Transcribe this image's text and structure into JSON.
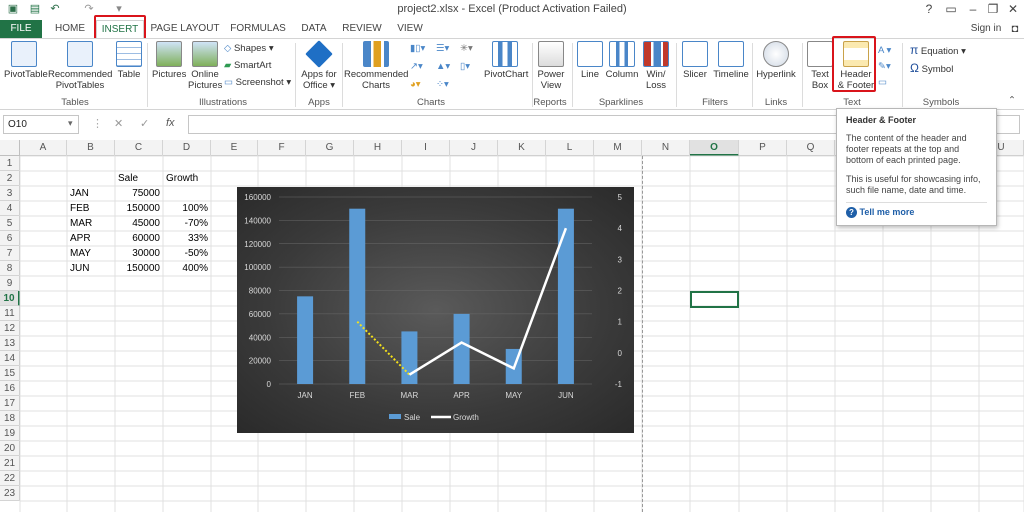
{
  "window": {
    "title": "project2.xlsx - Excel (Product Activation Failed)",
    "help": "?",
    "signin": "Sign in"
  },
  "tabs": [
    "FILE",
    "HOME",
    "INSERT",
    "PAGE LAYOUT",
    "FORMULAS",
    "DATA",
    "REVIEW",
    "VIEW"
  ],
  "ribbon": {
    "groups": [
      "Tables",
      "Illustrations",
      "Apps",
      "Charts",
      "Reports",
      "Sparklines",
      "Filters",
      "Links",
      "Text",
      "Symbols"
    ],
    "pivottable": "PivotTable",
    "recommended_pivot": [
      "Recommended",
      "PivotTables"
    ],
    "table": "Table",
    "pictures": "Pictures",
    "online_pictures": [
      "Online",
      "Pictures"
    ],
    "shapes": "Shapes",
    "smartart": "SmartArt",
    "screenshot": "Screenshot",
    "apps_for_office": [
      "Apps for",
      "Office"
    ],
    "recommended_charts": [
      "Recommended",
      "Charts"
    ],
    "pivotchart": "PivotChart",
    "power_view": [
      "Power",
      "View"
    ],
    "line": "Line",
    "column": "Column",
    "winloss": [
      "Win/",
      "Loss"
    ],
    "slicer": "Slicer",
    "timeline": "Timeline",
    "hyperlink": "Hyperlink",
    "textbox": [
      "Text",
      "Box"
    ],
    "header_footer": [
      "Header",
      "& Footer"
    ],
    "equation": "Equation",
    "symbol": "Symbol"
  },
  "formula_bar": {
    "name_box": "O10",
    "fx": "fx",
    "value": ""
  },
  "columns": [
    "A",
    "B",
    "C",
    "D",
    "E",
    "F",
    "G",
    "H",
    "I",
    "J",
    "K",
    "L",
    "M",
    "N",
    "O",
    "P",
    "Q",
    "R",
    "S",
    "T",
    "U"
  ],
  "rows": [
    "1",
    "2",
    "3",
    "4",
    "5",
    "6",
    "7",
    "8",
    "9",
    "10",
    "11",
    "12",
    "13",
    "14",
    "15",
    "16",
    "17",
    "18",
    "19",
    "20",
    "21",
    "22",
    "23"
  ],
  "table": {
    "headers": [
      "Sale",
      "Growth"
    ],
    "rows": [
      [
        "JAN",
        "75000",
        ""
      ],
      [
        "FEB",
        "150000",
        "100%"
      ],
      [
        "MAR",
        "45000",
        "-70%"
      ],
      [
        "APR",
        "60000",
        "33%"
      ],
      [
        "MAY",
        "30000",
        "-50%"
      ],
      [
        "JUN",
        "150000",
        "400%"
      ]
    ]
  },
  "chart_data": {
    "type": "bar",
    "categories": [
      "JAN",
      "FEB",
      "MAR",
      "APR",
      "MAY",
      "JUN"
    ],
    "series": [
      {
        "name": "Sale",
        "type": "bar",
        "axis": "left",
        "values": [
          75000,
          150000,
          45000,
          60000,
          30000,
          150000
        ]
      },
      {
        "name": "Growth",
        "type": "line",
        "axis": "right",
        "values": [
          null,
          1,
          -0.7,
          0.33,
          -0.5,
          4
        ]
      }
    ],
    "ylim": [
      0,
      160000
    ],
    "y_ticks": [
      "0",
      "20000",
      "40000",
      "60000",
      "80000",
      "100000",
      "120000",
      "140000",
      "160000"
    ],
    "y2lim": [
      -1,
      5
    ],
    "y2_ticks": [
      "-1",
      "0",
      "1",
      "2",
      "3",
      "4",
      "5"
    ],
    "legend": "bottom",
    "colors": {
      "bar": "#5b9bd5",
      "line": "#ffffff",
      "dotted": "#f4e11a"
    }
  },
  "tooltip": {
    "title": "Header & Footer",
    "body1": "The content of the header and footer repeats at the top and bottom of each printed page.",
    "body2": "This is useful for showcasing info, such file name, date and time.",
    "link": "Tell me more"
  }
}
